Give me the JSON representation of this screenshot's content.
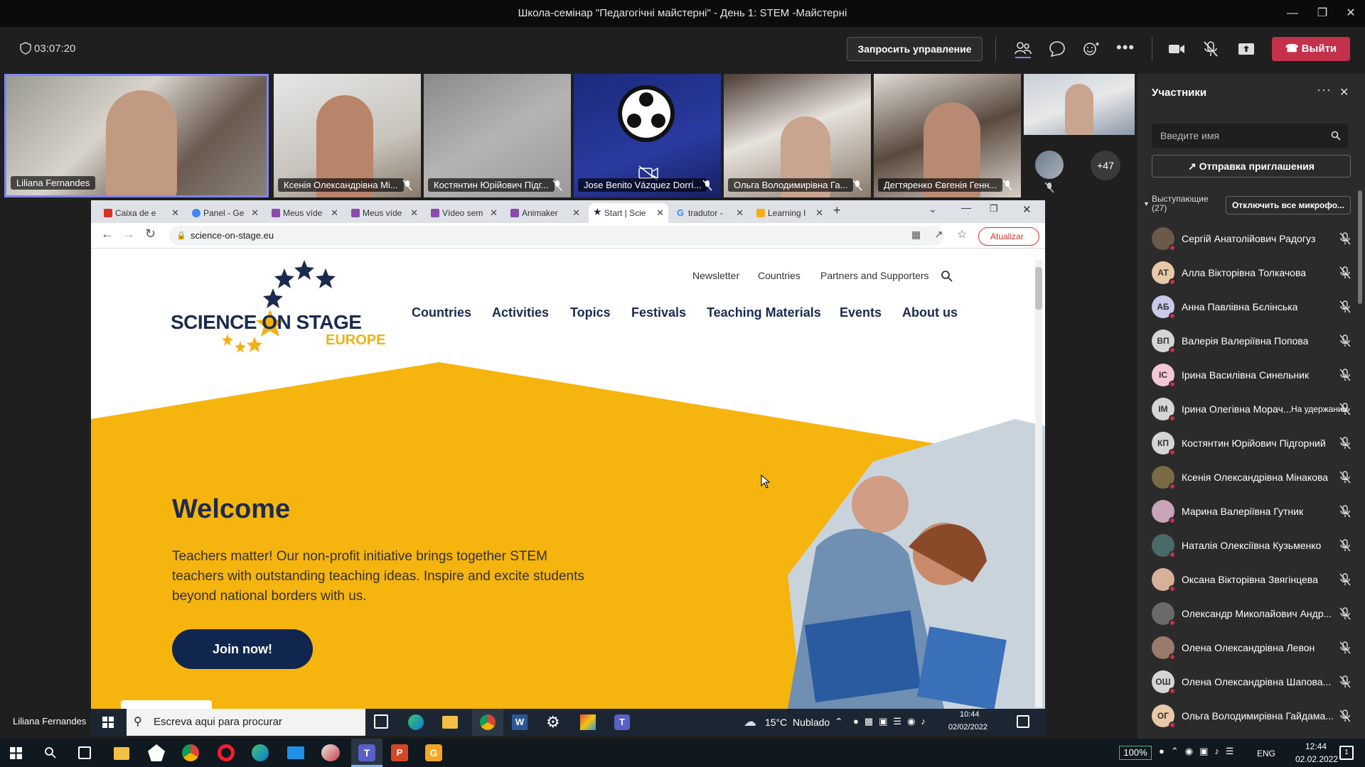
{
  "window": {
    "title": "Школа-семінар \"Педагогічні майстерні\" - День 1: STEM -Майстерні"
  },
  "toolbar": {
    "timer": "03:07:20",
    "request_control_label": "Запросить управление",
    "leave_label": "Выйти"
  },
  "video_tiles": [
    {
      "name": "Liliana Fernandes"
    },
    {
      "name": "Ксенія Олександрівна Мі..."
    },
    {
      "name": "Костянтин Юрійович Підг..."
    },
    {
      "name": "Jose Benito Vázquez Dorrí..."
    },
    {
      "name": "Ольга Володимирівна Га..."
    },
    {
      "name": "Дегтяренко Євгенія Генн..."
    }
  ],
  "overflow_count": "+47",
  "presenter_label": "Liliana Fernandes",
  "browser": {
    "tabs": [
      {
        "label": "Caixa de e",
        "color": "#d93025"
      },
      {
        "label": "Panel - Ge",
        "color": "#4285f4"
      },
      {
        "label": "Meus víde",
        "color": "#8a4baf"
      },
      {
        "label": "Meus víde",
        "color": "#8a4baf"
      },
      {
        "label": "Vídeo sem",
        "color": "#8a4baf"
      },
      {
        "label": "Animaker",
        "color": "#8a4baf"
      },
      {
        "label": "Start | Scie",
        "color": "#1b2b4f"
      },
      {
        "label": "tradutor -",
        "color": "#4285f4"
      },
      {
        "label": "Learning I",
        "color": "#f1b116"
      }
    ],
    "url": "science-on-stage.eu",
    "update_label": "Atualizar"
  },
  "site": {
    "top_nav": [
      "Newsletter",
      "Countries",
      "Partners and Supporters"
    ],
    "main_nav": [
      "Countries",
      "Activities",
      "Topics",
      "Festivals",
      "Teaching Materials",
      "Events",
      "About us"
    ],
    "logo_line1": "SCIENCE ON STAGE",
    "logo_line2": "EUROPE",
    "welcome": "Welcome",
    "intro": "Teachers matter! Our non-profit initiative brings together STEM teachers with outstanding teaching ideas. Inspire and excite students beyond national borders with us.",
    "join_label": "Join now!",
    "brand_yellow": "#f1b116",
    "brand_navy": "#1b2b4f"
  },
  "inner_taskbar": {
    "search_placeholder": "Escreva aqui para procurar",
    "weather": "15°C  Nublado",
    "time": "10:44",
    "date": "02/02/2022"
  },
  "outer_taskbar": {
    "zoom": "100%",
    "lang": "ENG",
    "time": "12:44",
    "date": "02.02.2022"
  },
  "participants": {
    "title": "Участники",
    "search_placeholder": "Введите имя",
    "invite_label": "Отправка приглашения",
    "speakers_label": "Выступающие (27)",
    "mute_all_label": "Отключить все микрофо...",
    "people": [
      {
        "name": "Сергій Анатолійович Радогуз",
        "initials": "",
        "color": "#6b5a4a"
      },
      {
        "name": "Алла Вікторівна Толкачова",
        "initials": "АТ",
        "color": "#e8c9a7"
      },
      {
        "name": "Анна Павлівна Бєлінська",
        "initials": "АБ",
        "color": "#c9c9ea"
      },
      {
        "name": "Валерія Валеріївна Попова",
        "initials": "ВП",
        "color": "#d5d5d5"
      },
      {
        "name": "Ірина Василівна Синельник",
        "initials": "ІС",
        "color": "#f2c9d2"
      },
      {
        "name": "Ірина Олегівна Морач...",
        "initials": "ІМ",
        "color": "#d5d5d5",
        "status": "На удержании"
      },
      {
        "name": "Костянтин Юрійович Підгорний",
        "initials": "КП",
        "color": "#d5d5d5"
      },
      {
        "name": "Ксенія Олександрівна Мінакова",
        "initials": "",
        "color": "#7a6a45"
      },
      {
        "name": "Марина Валеріївна Гутник",
        "initials": "",
        "color": "#c9a4b9"
      },
      {
        "name": "Наталія Олексіївна Кузьменко",
        "initials": "",
        "color": "#4a6a6a"
      },
      {
        "name": "Оксана Вікторівна Звягінцева",
        "initials": "",
        "color": "#d6b09a"
      },
      {
        "name": "Олександр Миколайович Андр...",
        "initials": "",
        "color": "#6a6a6a"
      },
      {
        "name": "Олена Олександрівна Левон",
        "initials": "",
        "color": "#9a7a6a"
      },
      {
        "name": "Олена Олександрівна Шапова...",
        "initials": "ОШ",
        "color": "#d5d5d5"
      },
      {
        "name": "Ольга Володимирівна Гайдама...",
        "initials": "ОГ",
        "color": "#e8c9a7"
      }
    ]
  }
}
